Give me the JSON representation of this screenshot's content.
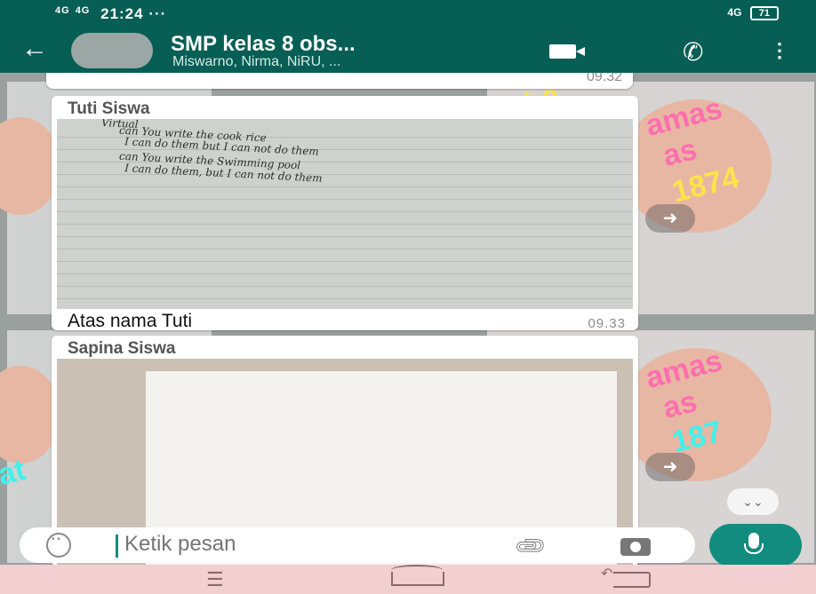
{
  "status_bar": {
    "signal1": "4G",
    "signal2": "4G",
    "time": "21:24",
    "extra": "···",
    "network": "4G",
    "battery": "71"
  },
  "header": {
    "back_icon": "arrow-left-icon",
    "title": "SMP kelas 8 obs...",
    "subtitle": "Miswarno, Nirma, NiRU, ...",
    "video_icon": "video-call-icon",
    "call_icon": "phone-icon",
    "menu_icon": "more-vertical-icon"
  },
  "messages": [
    {
      "time": "09.32"
    },
    {
      "sender": "Tuti Siswa",
      "handwriting": [
        "Virtual",
        "can You write the cook rice",
        "I can do them but I can not do them",
        "can You write the Swimming pool",
        "I can do them, but I can not do them"
      ],
      "caption": "Atas nama Tuti",
      "time": "09.33"
    },
    {
      "sender": "Sapina Siswa"
    }
  ],
  "composer": {
    "placeholder": "Ketik pesan"
  },
  "colors": {
    "header": "#075e54",
    "accent": "#128c7e",
    "navbar": "#f2cfd1"
  }
}
